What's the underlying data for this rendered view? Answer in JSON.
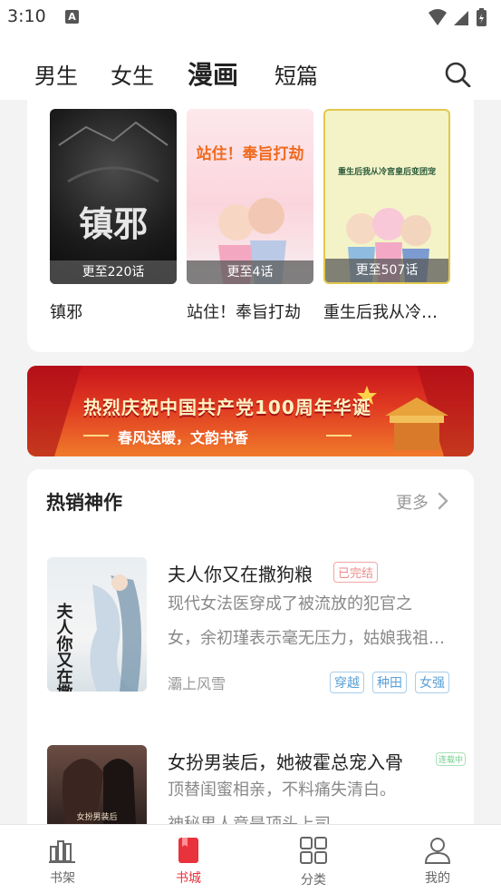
{
  "status_bar": {
    "time": "3:10",
    "notification_glyph": "A"
  },
  "top_nav": {
    "tabs": [
      {
        "label": "男生",
        "active": false
      },
      {
        "label": "女生",
        "active": false
      },
      {
        "label": "漫画",
        "active": true
      },
      {
        "label": "短篇",
        "active": false
      }
    ],
    "accent": "#e8323c"
  },
  "comics": [
    {
      "title": "镇邪",
      "chapter_text": "更至220话",
      "cover_text": "镇邪"
    },
    {
      "title": "站住！奉旨打劫",
      "chapter_text": "更至4话",
      "cover_text": "站住！奉旨打劫"
    },
    {
      "title": "重生后我从冷…",
      "chapter_text": "更至507话",
      "cover_text": "重生后我从冷宫皇后变团宠"
    }
  ],
  "banner": {
    "main_text": "热烈庆祝中国共产党100周年华诞",
    "sub_text": "春风送暖，文韵书香"
  },
  "hot_section": {
    "title": "热销神作",
    "more_label": "更多",
    "books": [
      {
        "title": "夫人你又在撒狗粮",
        "badge": "已完结",
        "desc_line1": "现代女法医穿成了被流放的犯官之",
        "desc_line2": "女，余初瑾表示毫无压力，姑娘我祖…",
        "author": "灞上风雪",
        "tags": [
          "穿越",
          "种田",
          "女强"
        ],
        "cover_text": "夫人你又在撒狗粮"
      },
      {
        "title": "女扮男装后，她被霍总宠入骨",
        "badge": "连载中",
        "desc_line1": "顶替闺蜜相亲，不料痛失清白。",
        "desc_line2": "神秘男人竟是顶头上司",
        "cover_text": "女扮男装后"
      }
    ]
  },
  "bottom_nav": [
    {
      "label": "书架",
      "active": false
    },
    {
      "label": "书城",
      "active": true
    },
    {
      "label": "分类",
      "active": false
    },
    {
      "label": "我的",
      "active": false
    }
  ]
}
